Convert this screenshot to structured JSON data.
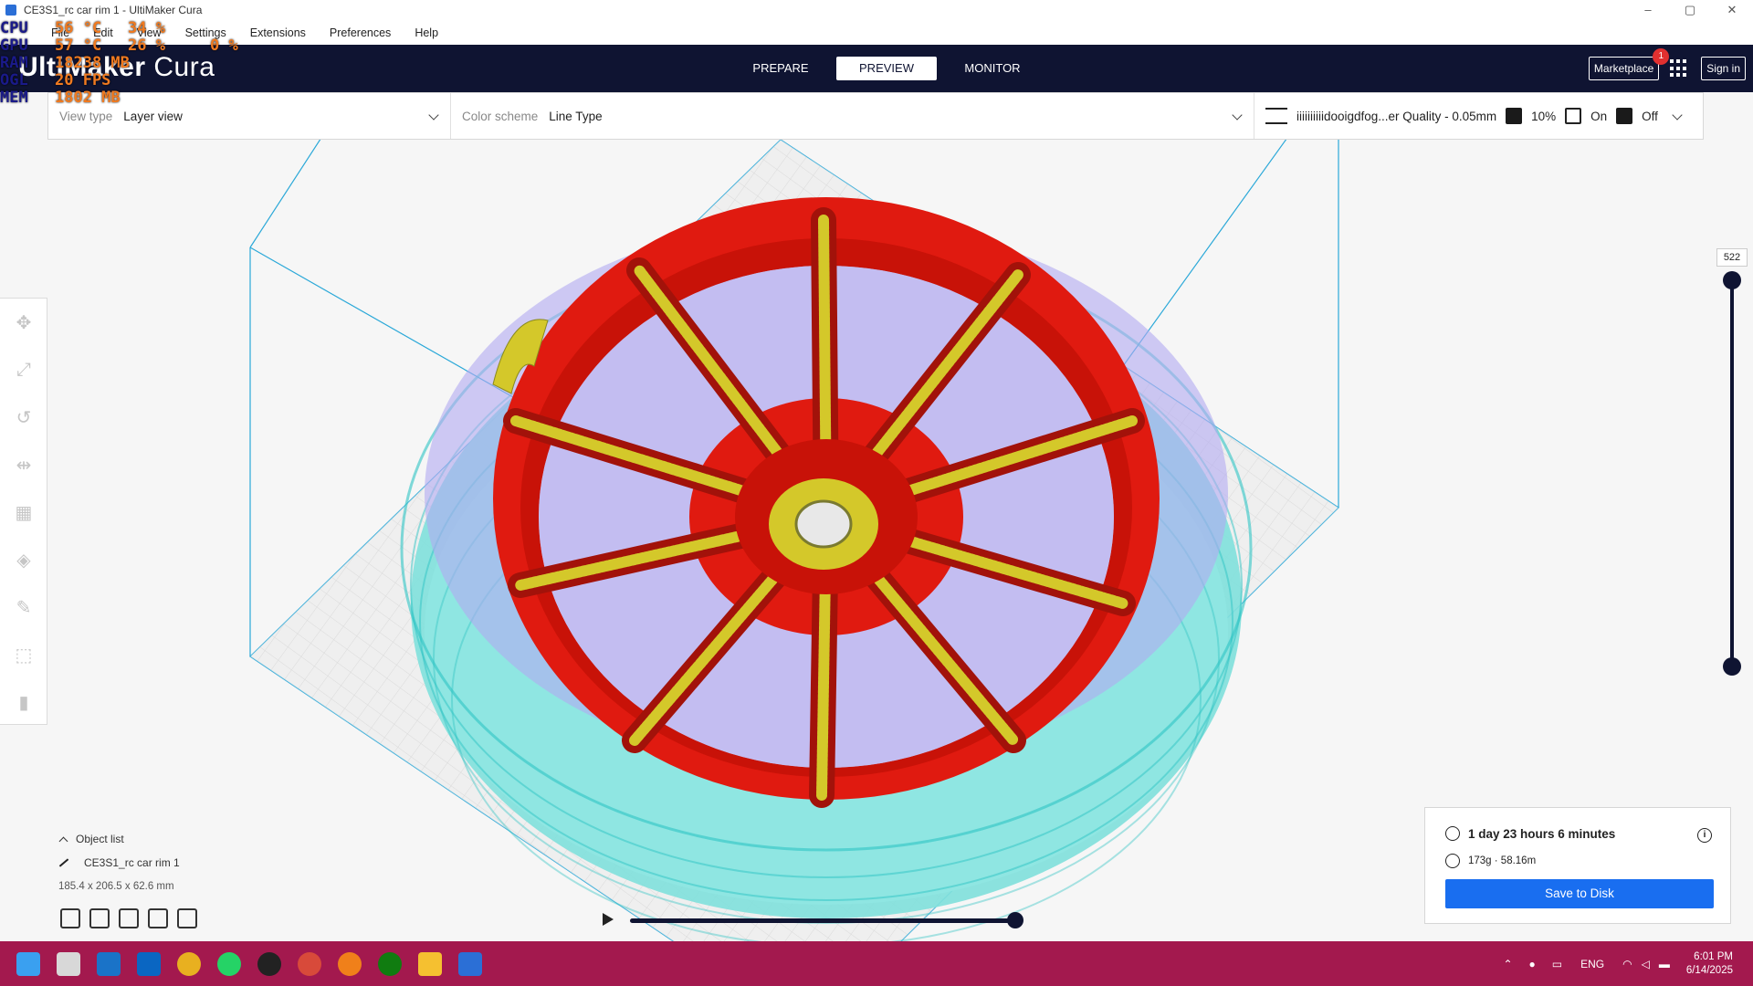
{
  "window": {
    "title": "CE3S1_rc car rim 1 - UltiMaker Cura",
    "controls": [
      "–",
      "▢",
      "✕"
    ]
  },
  "menu": [
    "File",
    "Edit",
    "View",
    "Settings",
    "Extensions",
    "Preferences",
    "Help"
  ],
  "header": {
    "logo_a": "UltiMaker",
    "logo_b": "Cura",
    "tabs": [
      "PREPARE",
      "PREVIEW",
      "MONITOR"
    ],
    "active_tab": "PREVIEW",
    "marketplace": "Marketplace",
    "marketplace_badge": "1",
    "signin": "Sign in"
  },
  "controlbar": {
    "view_type_label": "View type",
    "view_type_value": "Layer view",
    "color_scheme_label": "Color scheme",
    "color_scheme_value": "Line Type",
    "profile": "iiiiiiiiiidooigdfog...er Quality - 0.05mm",
    "infill": "10%",
    "support": "On",
    "adhesion": "Off"
  },
  "layer": {
    "current": "522",
    "top_fraction": 1.0,
    "bottom_fraction": 0.0
  },
  "object_list": {
    "header": "Object list",
    "item": "CE3S1_rc car rim 1",
    "dimensions": "185.4 x 206.5 x 62.6 mm"
  },
  "simulation": {
    "progress_fraction": 1.0
  },
  "print_info": {
    "time": "1 day 23 hours 6 minutes",
    "material": "173g · 58.16m",
    "save_button": "Save to Disk"
  },
  "hwmon": [
    {
      "key": "CPU",
      "v1": "56 °C",
      "v2": "34 %"
    },
    {
      "key": "GPU",
      "v1": "57 °C",
      "v2": "26 %",
      "v3": "0 %"
    },
    {
      "key": "RAM",
      "v1": "18238 MB"
    },
    {
      "key": "OGL",
      "v1": "20 FPS"
    },
    {
      "key": "MEM",
      "v1": "1802 MB"
    }
  ],
  "taskbar": {
    "lang": "ENG",
    "time": "6:01 PM",
    "date": "6/14/2025"
  },
  "colors": {
    "header_bg": "#0f1432",
    "accent": "#196ef0",
    "taskbar": "#a3194e",
    "shell": "#e01a10",
    "spokes": "#d4c82a",
    "support": "#7ee0e0",
    "travel": "#a9a0f0"
  }
}
